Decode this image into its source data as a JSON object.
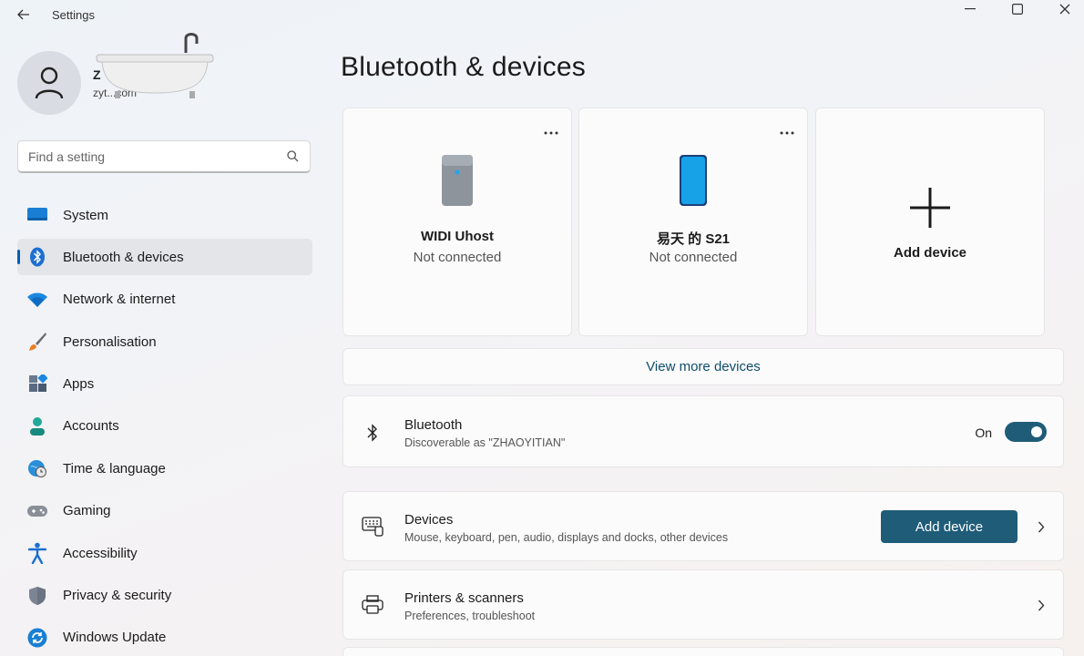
{
  "window": {
    "title": "Settings",
    "back_icon": "back-arrow-icon",
    "minimize_icon": "minimize-icon",
    "maximize_icon": "maximize-icon",
    "close_icon": "close-icon"
  },
  "profile": {
    "name": "Z",
    "email": "zyt...com"
  },
  "search": {
    "placeholder": "Find a setting",
    "value": ""
  },
  "sidebar": {
    "active_index": 1,
    "items": [
      {
        "label": "System",
        "icon": "system-icon"
      },
      {
        "label": "Bluetooth & devices",
        "icon": "bluetooth-icon"
      },
      {
        "label": "Network & internet",
        "icon": "wifi-icon"
      },
      {
        "label": "Personalisation",
        "icon": "brush-icon"
      },
      {
        "label": "Apps",
        "icon": "apps-icon"
      },
      {
        "label": "Accounts",
        "icon": "account-icon"
      },
      {
        "label": "Time & language",
        "icon": "globe-clock-icon"
      },
      {
        "label": "Gaming",
        "icon": "gamepad-icon"
      },
      {
        "label": "Accessibility",
        "icon": "accessibility-icon"
      },
      {
        "label": "Privacy & security",
        "icon": "shield-icon"
      },
      {
        "label": "Windows Update",
        "icon": "update-icon"
      }
    ]
  },
  "main": {
    "title": "Bluetooth & devices",
    "devices": [
      {
        "name": "WIDI Uhost",
        "status": "Not connected",
        "icon": "usb-host-device-icon"
      },
      {
        "name": "易天 的 S21",
        "status": "Not connected",
        "icon": "phone-icon"
      }
    ],
    "add_device_card": {
      "label": "Add device",
      "icon": "plus-icon"
    },
    "view_more": "View more devices",
    "bluetooth": {
      "title": "Bluetooth",
      "subtitle": "Discoverable as \"ZHAOYITIAN\"",
      "toggle_label": "On",
      "toggle_on": true
    },
    "devices_row": {
      "title": "Devices",
      "subtitle": "Mouse, keyboard, pen, audio, displays and docks, other devices",
      "button": "Add device"
    },
    "printers_row": {
      "title": "Printers & scanners",
      "subtitle": "Preferences, troubleshoot"
    }
  },
  "colors": {
    "accent": "#1f5c78",
    "active_indicator": "#005fb8",
    "link": "#0f4d6a"
  }
}
